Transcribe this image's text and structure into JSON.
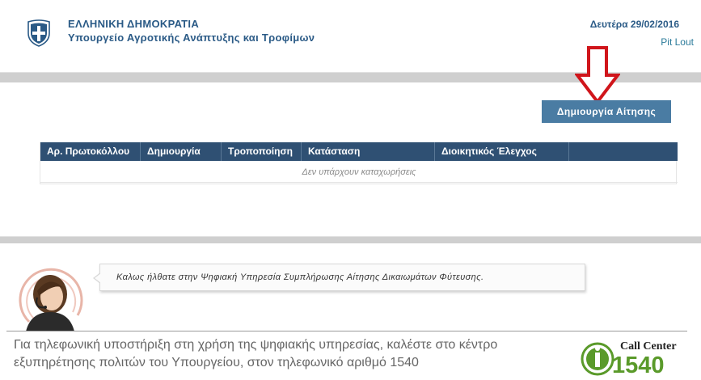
{
  "header": {
    "country": "ΕΛΛΗΝΙΚΗ ΔΗΜΟΚΡΑΤΙΑ",
    "ministry": "Υπουργείο Αγροτικής Ανάπτυξης και Τροφίμων",
    "date": "Δευτέρα 29/02/2016",
    "user": "Pit Lout",
    "emblem_icon": "greek-coat-of-arms-icon"
  },
  "actions": {
    "create_label": "Δημιουργία Αίτησης",
    "arrow_icon": "red-down-arrow-icon"
  },
  "table": {
    "columns": [
      "Αρ. Πρωτοκόλλου",
      "Δημιουργία",
      "Τροποποίηση",
      "Κατάσταση",
      "Διοικητικός Έλεγχος",
      ""
    ],
    "empty_message": "Δεν υπάρχουν καταχωρήσεις"
  },
  "footer": {
    "welcome_message": "Καλως ήλθατε στην Ψηφιακή Υπηρεσία Συμπλήρωσης Αίτησης Δικαιωμάτων Φύτευσης.",
    "support_text": "Για τηλεφωνική υποστήριξη στη χρήση της ψηφιακής υπηρεσίας, καλέστε στο κέντρο εξυπηρέτησης πολιτών του Υπουργείου, στον τηλεφωνικό αριθμό 1540",
    "call_center_label": "Call Center",
    "call_center_number": "1540"
  },
  "colors": {
    "brand_blue": "#2a5a86",
    "header_row": "#2f5073",
    "button": "#4a7ca3",
    "arrow_red": "#d0151b",
    "logo_green": "#5a9a2a"
  }
}
